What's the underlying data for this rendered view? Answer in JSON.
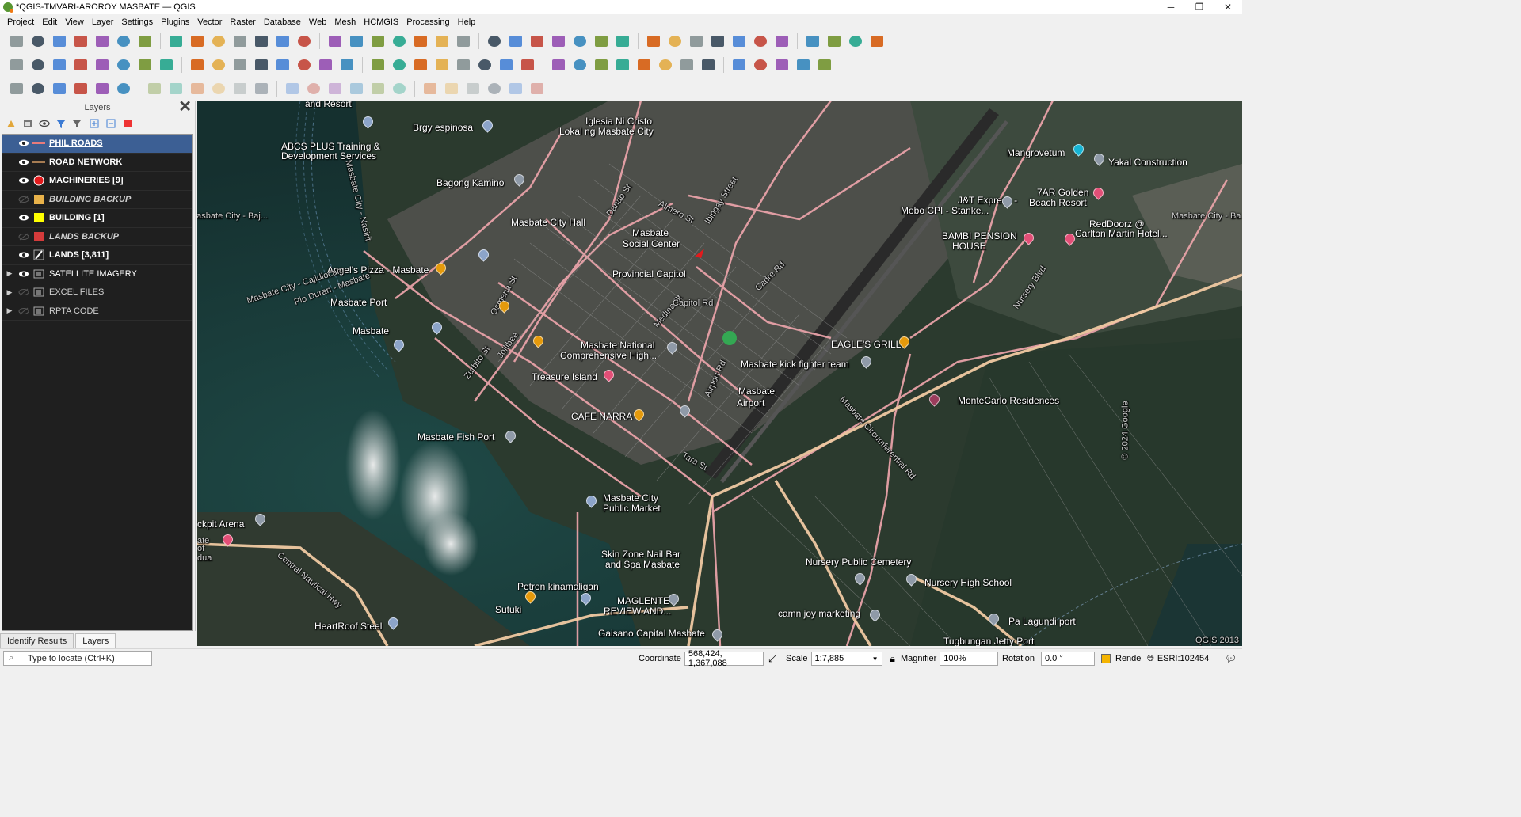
{
  "window": {
    "title": "*QGIS-TMVARI-AROROY MASBATE — QGIS",
    "controls": [
      "─",
      "❐",
      "✕"
    ]
  },
  "menu": [
    "Project",
    "Edit",
    "View",
    "Layer",
    "Settings",
    "Plugins",
    "Vector",
    "Raster",
    "Database",
    "Web",
    "Mesh",
    "HCMGIS",
    "Processing",
    "Help"
  ],
  "toolbar_icons": {
    "row1": [
      "new-project-icon",
      "open-project-icon",
      "save-project-icon",
      "print-layout-icon",
      "layout-manager-icon",
      "style-manager-icon",
      "pan-icon",
      "pan-to-selection-icon",
      "zoom-in-icon",
      "zoom-out-icon",
      "zoom-full-icon",
      "zoom-to-selection-icon",
      "zoom-to-layer-icon",
      "zoom-native-icon",
      "zoom-last-icon",
      "zoom-next-icon",
      "new-map-view-icon",
      "new-3d-view-icon",
      "new-bookmark-icon",
      "show-bookmarks-icon",
      "temporal-controller-icon",
      "refresh-icon",
      "identify-icon",
      "attribute-table-icon",
      "settings-icon",
      "statistics-icon",
      "open-table-icon",
      "measure-icon",
      "map-tips-icon",
      "zoom-scale-icon",
      "select-features-icon",
      "select-by-value-icon",
      "deselect-icon",
      "select-location-icon",
      "db-manager-icon",
      "processing-toolbox-icon",
      "python-icon",
      "plugin-icon",
      "help-icon"
    ],
    "row2": [
      "edit-pencil-icon",
      "toggle-editing-icon",
      "save-edits-icon",
      "digitize-icon",
      "add-feature-icon",
      "vertex-tool-icon",
      "delete-icon",
      "cut-icon",
      "copy-icon",
      "paste-icon",
      "undo-icon",
      "redo-icon",
      "snapping-icon",
      "topology-icon",
      "trace-icon",
      "split-icon",
      "add-ring-icon",
      "reshape-icon",
      "offset-icon",
      "globe-icon",
      "wms-icon",
      "wfs-icon",
      "add-point-icon",
      "add-layer-icon",
      "add-vector-icon",
      "add-line-icon",
      "add-raster-icon",
      "grid-icon",
      "label-icon",
      "layer-label-icon",
      "label-pin-icon",
      "label-hide-icon",
      "label-move-icon",
      "label-rotate-icon",
      "label-change-icon",
      "label-show-icon",
      "label-highlight-icon"
    ],
    "row3": [
      "magnet-icon",
      "advanced-digitize-icon",
      "eye-tool-icon",
      "fork-icon",
      "gps-icon",
      "cross-icon",
      "split-parts-icon",
      "snap-icon",
      "merge-icon",
      "rotate-icon",
      "scale-icon",
      "simplify-icon",
      "fill-ring-icon",
      "delete-ring-icon",
      "delete-part-icon",
      "reshape-features-icon",
      "offset-curve-icon",
      "split-features-icon",
      "merge-attributes-icon",
      "rotate-point-symbols-icon",
      "offset-point-symbols-icon",
      "fill-icon",
      "grid-layer-icon",
      "pin-icon"
    ]
  },
  "layers_panel": {
    "title": "Layers",
    "close_symbol": "✕",
    "layers": [
      {
        "name": "PHIL ROADS",
        "visible": true,
        "symbol": "line",
        "color": "#e87b7b",
        "style": "underline",
        "selected": true,
        "expandable": false
      },
      {
        "name": "ROAD NETWORK",
        "visible": true,
        "symbol": "line",
        "color": "#a67c52",
        "style": "bold",
        "selected": false,
        "expandable": false
      },
      {
        "name": "MACHINERIES [9]",
        "visible": true,
        "symbol": "circle",
        "color": "#e31a1c",
        "style": "bold",
        "selected": false,
        "expandable": false
      },
      {
        "name": "BUILDING BACKUP",
        "visible": false,
        "symbol": "square",
        "color": "#e8b24a",
        "style": "italic",
        "selected": false,
        "expandable": false
      },
      {
        "name": "BUILDING [1]",
        "visible": true,
        "symbol": "square",
        "color": "#ffff00",
        "style": "bold",
        "selected": false,
        "expandable": false
      },
      {
        "name": "LANDS BACKUP",
        "visible": false,
        "symbol": "square",
        "color": "#d43b3b",
        "style": "italic",
        "selected": false,
        "expandable": false
      },
      {
        "name": "LANDS [3,811]",
        "visible": true,
        "symbol": "edit",
        "color": "#ffffff",
        "style": "bold",
        "selected": false,
        "expandable": false
      },
      {
        "name": "SATELLITE IMAGERY",
        "visible": true,
        "symbol": "group",
        "color": "#cccccc",
        "style": "normal",
        "selected": false,
        "expandable": true
      },
      {
        "name": "EXCEL FILES",
        "visible": false,
        "symbol": "group",
        "color": "#cccccc",
        "style": "normal",
        "selected": false,
        "expandable": true
      },
      {
        "name": "RPTA CODE",
        "visible": false,
        "symbol": "group",
        "color": "#cccccc",
        "style": "normal",
        "selected": false,
        "expandable": true
      }
    ]
  },
  "bottom_tabs": [
    "Identify Results",
    "Layers"
  ],
  "map_labels": [
    "and Resort",
    "Brgy espinosa",
    "Iglesia Ni Cristo",
    "Lokal ng Masbate City",
    "ABCS PLUS Training &",
    "Development Services",
    "Bagong Kamino",
    "Masbate City Hall",
    "Masbate",
    "Social Center",
    "Angel's Pizza - Masbate",
    "Provincial Capitol",
    "Masbate Port",
    "Masbate",
    "Masbate National",
    "Comprehensive High...",
    "Treasure Island",
    "CAFE NARRA",
    "Masbate Fish Port",
    "Masbate City",
    "Public Market",
    "Skin Zone Nail Bar",
    "and Spa Masbate",
    "Petron kinamaligan",
    "MAGLENTE",
    "REVIEW AND...",
    "Gaisano Capital Masbate",
    "HeartRoof Steel",
    "ckpit Arena",
    "Mangrovetum",
    "Yakal Construction",
    "7AR Golden",
    "Beach Resort",
    "J&T Express -",
    "Mobo CPI - Stanke...",
    "BAMBI PENSION",
    "HOUSE",
    "RedDoorz @",
    "Carlton Martin Hotel...",
    "EAGLE'S GRILL",
    "Masbate kick fighter team",
    "Masbate",
    "Airport",
    "MonteCarlo Residences",
    "Nursery Public Cemetery",
    "Nursery High School",
    "camn joy marketing",
    "Pa Lagundi port",
    "Tugbungan Jetty Port",
    "Sutuki",
    "Masbate City - Cajidiocan",
    "Pio Duran - Masbate",
    "Masbate City - Nasirit",
    "Danao St",
    "Almero St",
    "Ibingay Street",
    "Cadre Rd",
    "Nursery Blvd",
    "Osmena St",
    "Zurbito St",
    "Medina St",
    "Airport Rd",
    "Tara St",
    "Central Nautical Hwy",
    "Masbate Circumferential Rd",
    "Jollibee",
    "Masbate City - Baj...",
    "© 2024 Google",
    "QGIS 2013",
    "Capitol Rd",
    "ate",
    "of",
    "dua",
    "Masbate City - Ba"
  ],
  "status": {
    "locate_placeholder": "Type to locate (Ctrl+K)",
    "coordinate_label": "Coordinate",
    "coordinate_value": "568,424, 1,367,088",
    "scale_label": "Scale",
    "scale_value": "1:7,885",
    "magnifier_label": "Magnifier",
    "magnifier_value": "100%",
    "rotation_label": "Rotation",
    "rotation_value": "0.0 °",
    "render_label": "Render",
    "crs": "ESRI:102454"
  },
  "colors": {
    "road_pink": "#e8a2a8",
    "road_tan": "#f0c9a2",
    "selection_blue": "#3c5f94",
    "water_dark": "#16302f"
  }
}
